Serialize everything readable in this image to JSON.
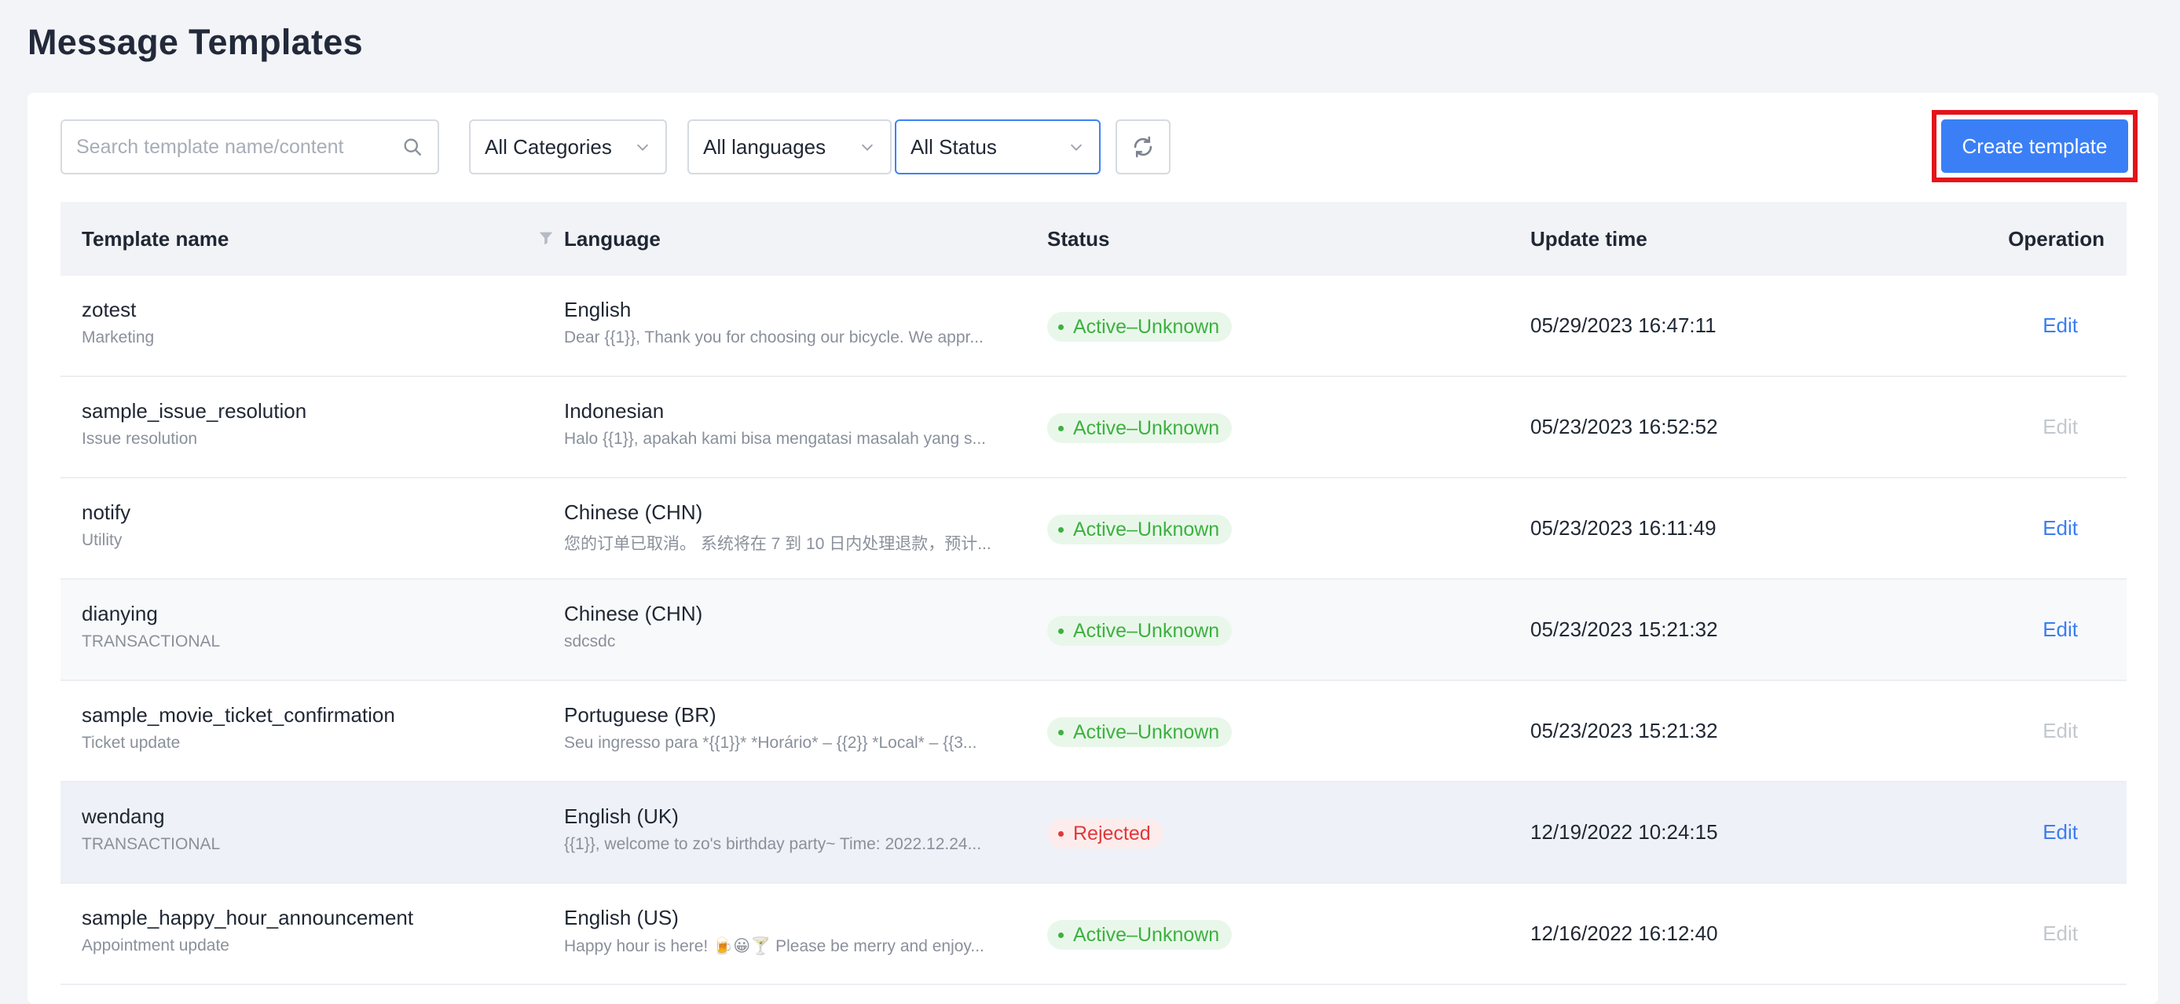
{
  "page": {
    "title": "Message Templates"
  },
  "toolbar": {
    "search_placeholder": "Search template name/content",
    "category_select": "All Categories",
    "language_select": "All languages",
    "status_select": "All Status",
    "create_label": "Create template"
  },
  "table": {
    "headers": {
      "name": "Template name",
      "language": "Language",
      "status": "Status",
      "update_time": "Update time",
      "operation": "Operation"
    },
    "rows": [
      {
        "name": "zotest",
        "category": "Marketing",
        "language": "English",
        "preview": "Dear {{1}}, Thank you for choosing our bicycle. We appr...",
        "status": "Active–Unknown",
        "status_type": "active",
        "update_time": "05/29/2023 16:47:11",
        "op": "Edit",
        "op_enabled": true
      },
      {
        "name": "sample_issue_resolution",
        "category": "Issue resolution",
        "language": "Indonesian",
        "preview": "Halo {{1}}, apakah kami bisa mengatasi masalah yang s...",
        "status": "Active–Unknown",
        "status_type": "active",
        "update_time": "05/23/2023 16:52:52",
        "op": "Edit",
        "op_enabled": false
      },
      {
        "name": "notify",
        "category": "Utility",
        "language": "Chinese (CHN)",
        "preview": "您的订单已取消。 系统将在 7 到 10 日内处理退款，预计...",
        "status": "Active–Unknown",
        "status_type": "active",
        "update_time": "05/23/2023 16:11:49",
        "op": "Edit",
        "op_enabled": true
      },
      {
        "name": "dianying",
        "category": "TRANSACTIONAL",
        "language": "Chinese (CHN)",
        "preview": "sdcsdc",
        "status": "Active–Unknown",
        "status_type": "active",
        "update_time": "05/23/2023 15:21:32",
        "op": "Edit",
        "op_enabled": true
      },
      {
        "name": "sample_movie_ticket_confirmation",
        "category": "Ticket update",
        "language": "Portuguese (BR)",
        "preview": "Seu ingresso para *{{1}}* *Horário* – {{2}} *Local* – {{3...",
        "status": "Active–Unknown",
        "status_type": "active",
        "update_time": "05/23/2023 15:21:32",
        "op": "Edit",
        "op_enabled": false
      },
      {
        "name": "wendang",
        "category": "TRANSACTIONAL",
        "language": "English (UK)",
        "preview": "{{1}}, welcome to zo's birthday party~ Time: 2022.12.24...",
        "status": "Rejected",
        "status_type": "rejected",
        "update_time": "12/19/2022 10:24:15",
        "op": "Edit",
        "op_enabled": true
      },
      {
        "name": "sample_happy_hour_announcement",
        "category": "Appointment update",
        "language": "English (US)",
        "preview": "Happy hour is here! 🍺😀🍸 Please be merry and enjoy...",
        "status": "Active–Unknown",
        "status_type": "active",
        "update_time": "12/16/2022 16:12:40",
        "op": "Edit",
        "op_enabled": false
      }
    ]
  },
  "colors": {
    "accent": "#3a7ff6",
    "active": "#3cb13f",
    "rejected": "#e1383b",
    "highlight_border": "#e3141b"
  }
}
